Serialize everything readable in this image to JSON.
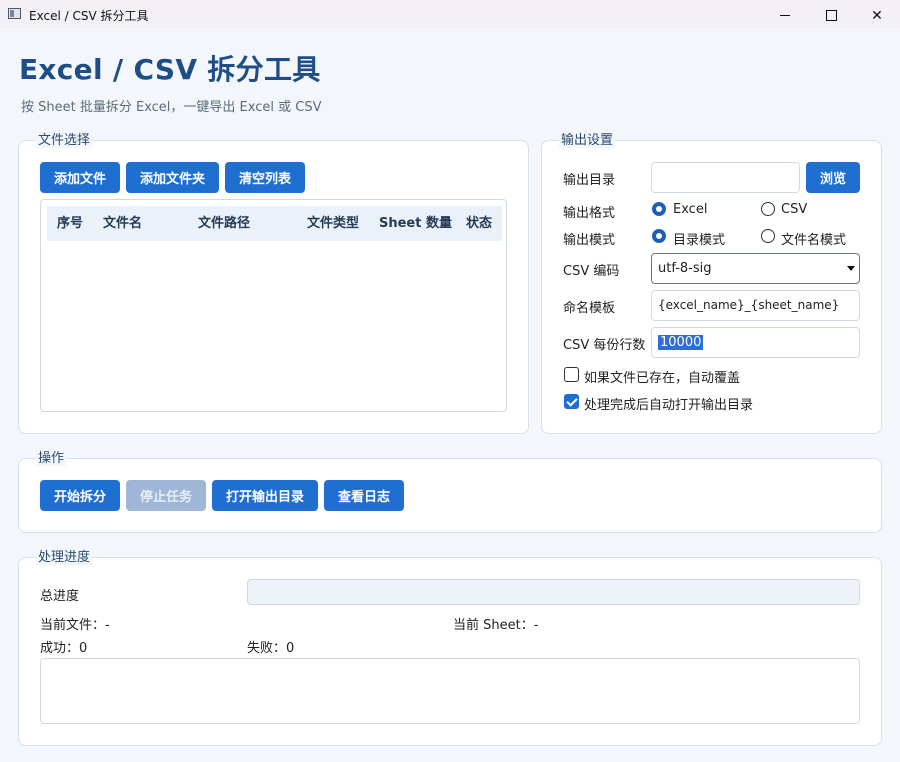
{
  "window": {
    "title": "Excel / CSV 拆分工具"
  },
  "header": {
    "title": "Excel / CSV 拆分工具",
    "subtitle": "按 Sheet 批量拆分 Excel，一键导出 Excel 或 CSV"
  },
  "file_group": {
    "label": "文件选择",
    "buttons": {
      "add_file": "添加文件",
      "add_folder": "添加文件夹",
      "clear_list": "清空列表"
    },
    "table": {
      "columns": [
        "序号",
        "文件名",
        "文件路径",
        "文件类型",
        "Sheet 数量",
        "状态"
      ],
      "rows": []
    }
  },
  "output_group": {
    "label": "输出设置",
    "dir_label": "输出目录",
    "dir_value": "",
    "browse": "浏览",
    "format_label": "输出格式",
    "format_options": [
      "Excel",
      "CSV"
    ],
    "format_selected": "Excel",
    "mode_label": "输出模式",
    "mode_options": [
      "目录模式",
      "文件名模式"
    ],
    "mode_selected": "目录模式",
    "encoding_label": "CSV 编码",
    "encoding_value": "utf-8-sig",
    "template_label": "命名模板",
    "template_value": "{excel_name}_{sheet_name}",
    "rows_label": "CSV 每份行数",
    "rows_value": "10000",
    "overwrite_label": "如果文件已存在，自动覆盖",
    "overwrite_checked": false,
    "open_dir_label": "处理完成后自动打开输出目录",
    "open_dir_checked": true
  },
  "actions_group": {
    "label": "操作",
    "start": "开始拆分",
    "stop": "停止任务",
    "open_output": "打开输出目录",
    "view_log": "查看日志"
  },
  "progress_group": {
    "label": "处理进度",
    "total_label": "总进度",
    "total_value": 0,
    "current_file": "当前文件：-",
    "current_sheet": "当前 Sheet：-",
    "success": "成功：0",
    "failed": "失败：0"
  },
  "colors": {
    "accent": "#1f6fd1",
    "title": "#1f4d86",
    "disabled": "#9fb7d6"
  },
  "icons": {
    "app": "app-window-icon",
    "minimize": "minimize-icon",
    "maximize": "maximize-icon",
    "close": "close-icon"
  }
}
